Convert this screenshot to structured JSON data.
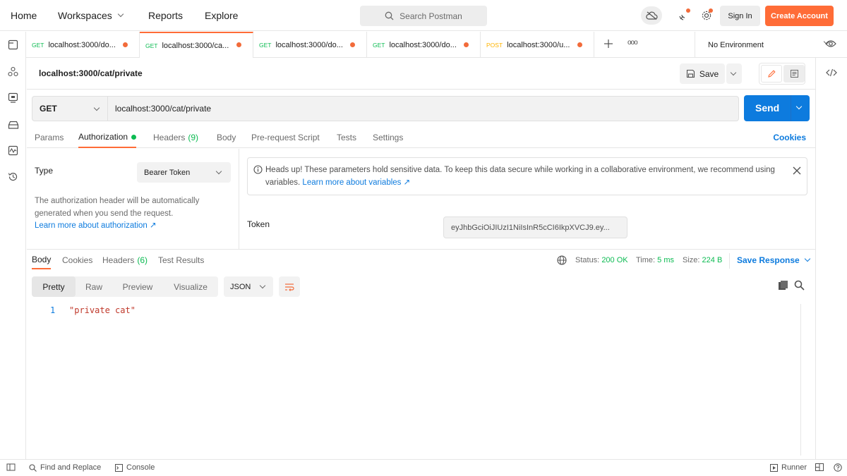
{
  "topbar": {
    "nav": [
      "Home",
      "Workspaces",
      "Reports",
      "Explore"
    ],
    "search_placeholder": "Search Postman",
    "sign_in": "Sign In",
    "create_account": "Create Account"
  },
  "request_tabs": [
    {
      "method": "GET",
      "label": "localhost:3000/do...",
      "active": false
    },
    {
      "method": "GET",
      "label": "localhost:3000/ca...",
      "active": true
    },
    {
      "method": "GET",
      "label": "localhost:3000/do...",
      "active": false
    },
    {
      "method": "GET",
      "label": "localhost:3000/do...",
      "active": false
    },
    {
      "method": "POST",
      "label": "localhost:3000/u...",
      "active": false
    }
  ],
  "tab_more": "ooo",
  "environment": "No Environment",
  "request": {
    "title": "localhost:3000/cat/private",
    "save_label": "Save",
    "method": "GET",
    "url": "localhost:3000/cat/private",
    "send_label": "Send"
  },
  "config_tabs": {
    "params": "Params",
    "authorization": "Authorization",
    "headers": "Headers",
    "headers_count": "(9)",
    "body": "Body",
    "prerequest": "Pre-request Script",
    "tests": "Tests",
    "settings": "Settings",
    "cookies": "Cookies"
  },
  "auth": {
    "type_label": "Type",
    "type_value": "Bearer Token",
    "description": "The authorization header will be automatically generated when you send the request.",
    "learn_more": "Learn more about authorization ↗",
    "notice_text": "Heads up! These parameters hold sensitive data. To keep this data secure while working in a collaborative environment, we recommend using variables.",
    "notice_link": "Learn more about variables ↗",
    "token_label": "Token",
    "token_value": "eyJhbGciOiJIUzI1NiIsInR5cCI6IkpXVCJ9.ey..."
  },
  "response": {
    "tabs": {
      "body": "Body",
      "cookies": "Cookies",
      "headers": "Headers",
      "headers_count": "(6)",
      "tests": "Test Results"
    },
    "status_label": "Status:",
    "status_value": "200 OK",
    "time_label": "Time:",
    "time_value": "5 ms",
    "size_label": "Size:",
    "size_value": "224 B",
    "save_response": "Save Response",
    "views": [
      "Pretty",
      "Raw",
      "Preview",
      "Visualize"
    ],
    "format": "JSON",
    "lines": [
      {
        "num": "1",
        "code": "\"private cat\""
      }
    ]
  },
  "bottombar": {
    "find_replace": "Find and Replace",
    "console": "Console",
    "runner": "Runner"
  },
  "colors": {
    "accent": "#ff6c37",
    "primary": "#0d7bde",
    "success": "#0cbb52"
  }
}
